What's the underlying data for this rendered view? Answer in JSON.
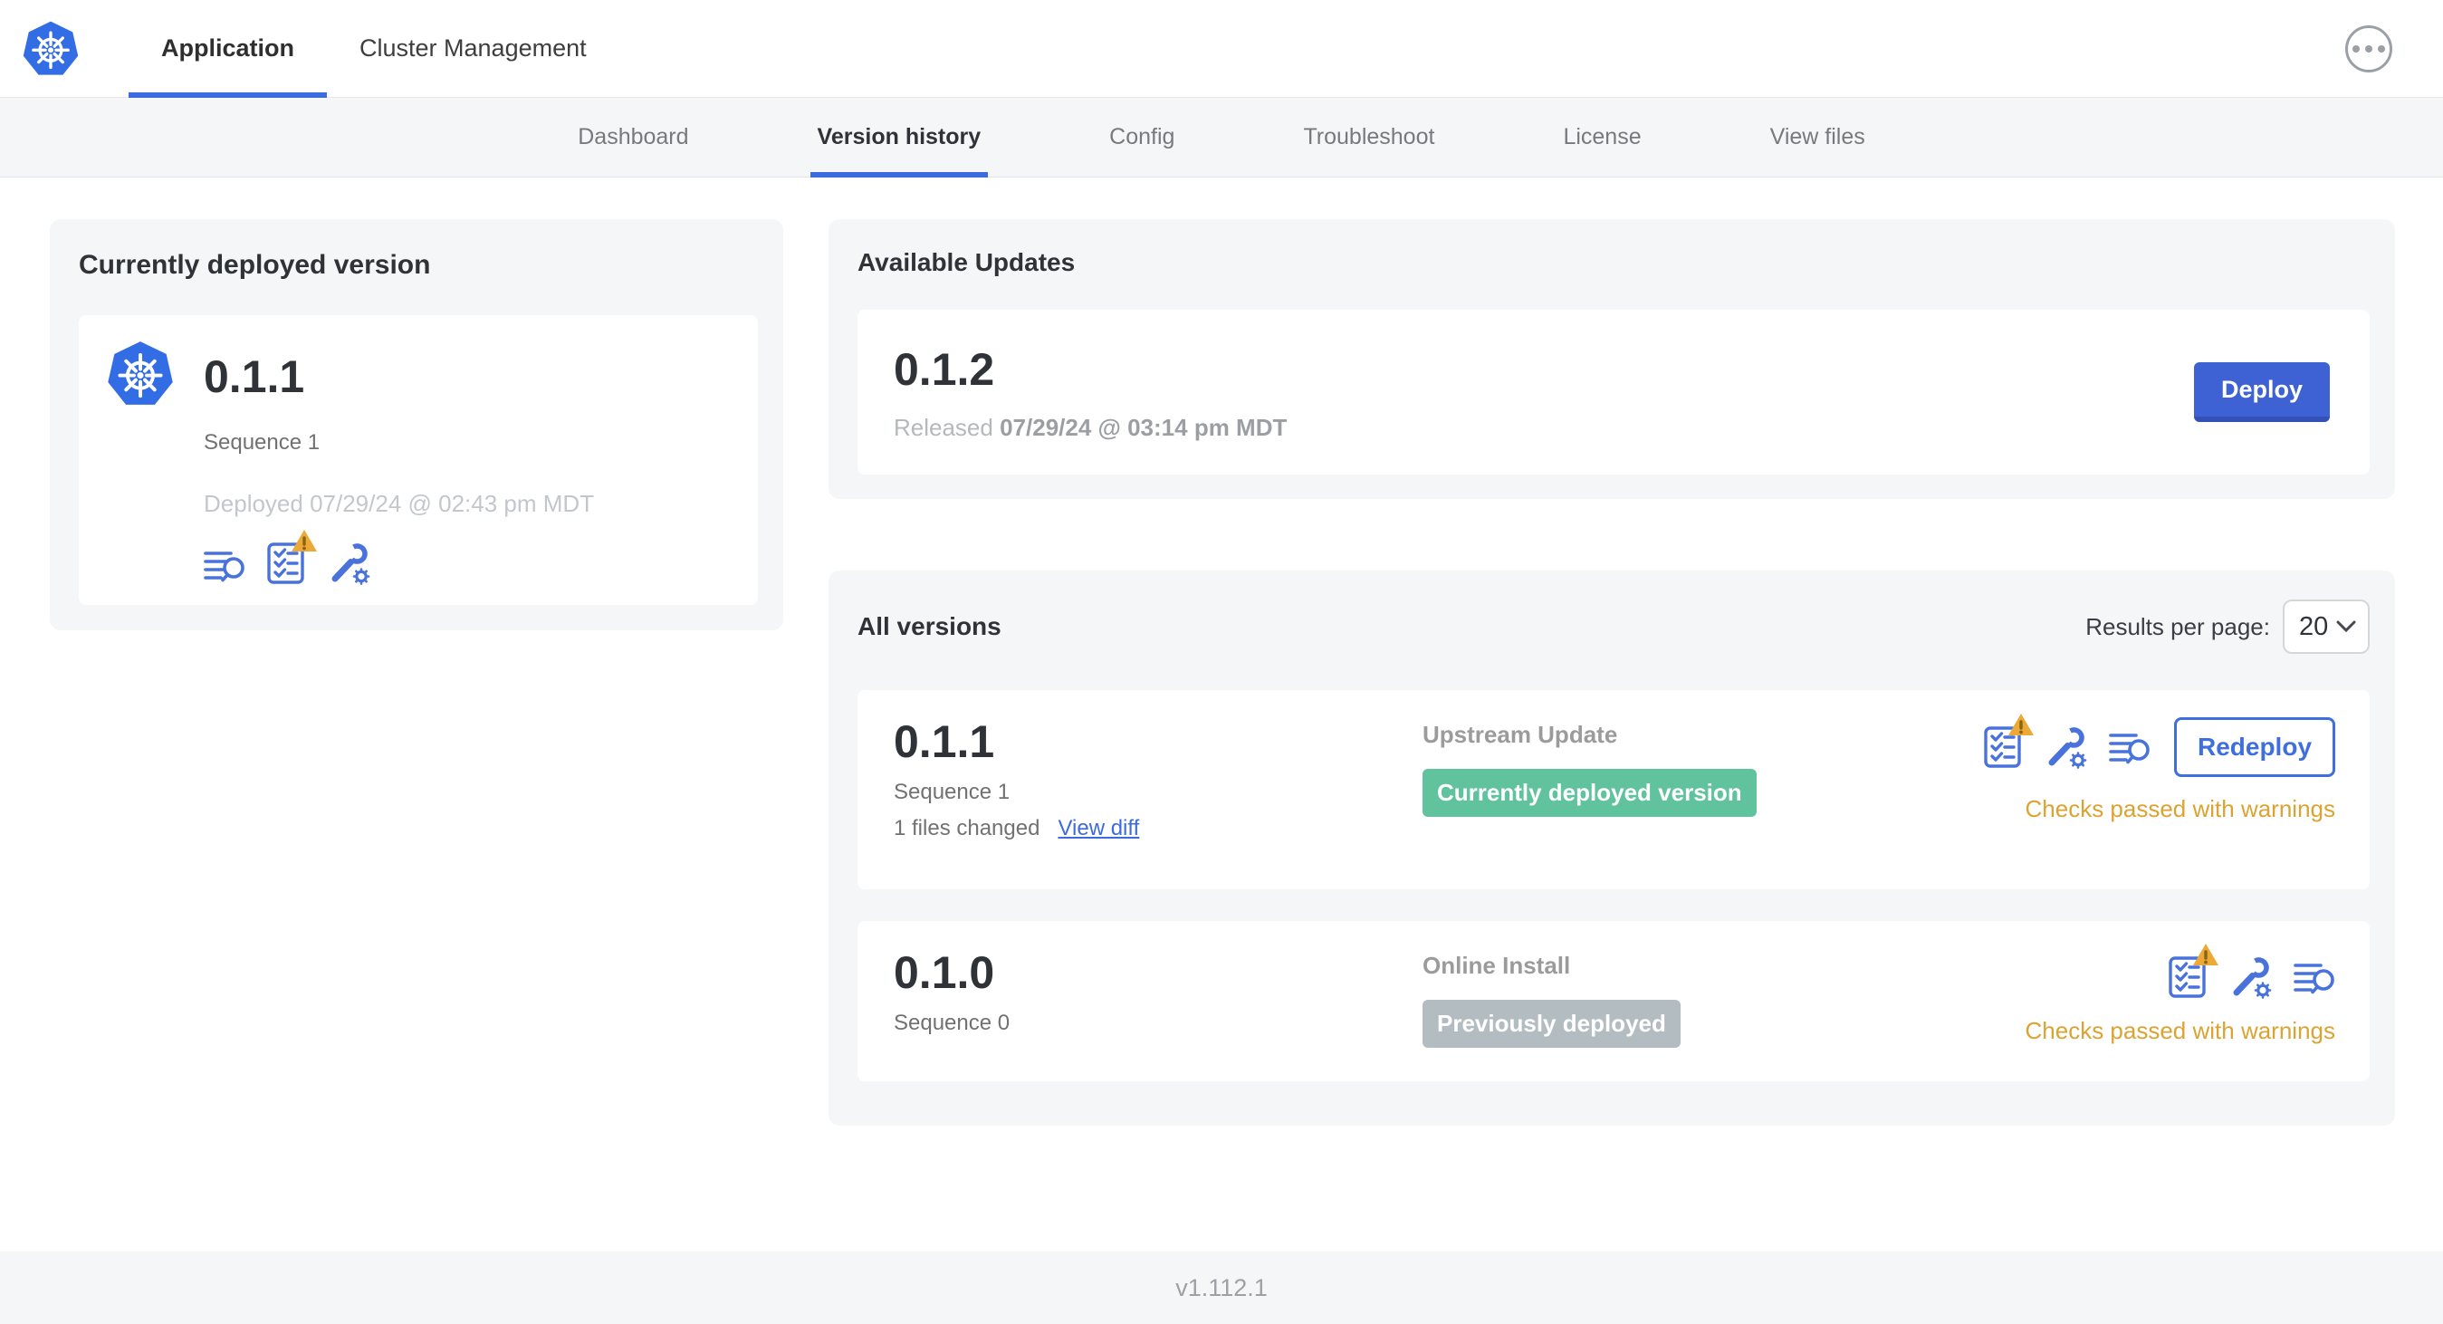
{
  "top_nav": {
    "tabs": [
      {
        "label": "Application",
        "active": true
      },
      {
        "label": "Cluster Management",
        "active": false
      }
    ],
    "overflow_menu_icon": "ellipsis-icon"
  },
  "sub_nav": {
    "tabs": [
      {
        "label": "Dashboard",
        "active": false
      },
      {
        "label": "Version history",
        "active": true
      },
      {
        "label": "Config",
        "active": false
      },
      {
        "label": "Troubleshoot",
        "active": false
      },
      {
        "label": "License",
        "active": false
      },
      {
        "label": "View files",
        "active": false
      }
    ]
  },
  "current_version_card": {
    "title": "Currently deployed version",
    "version": "0.1.1",
    "sequence": "Sequence 1",
    "deployed_text": "Deployed 07/29/24 @ 02:43 pm MDT",
    "icons": [
      "release-notes-icon",
      "preflight-checks-warning-icon",
      "config-icon"
    ],
    "app_icon": "kubernetes-logo"
  },
  "available_updates": {
    "title": "Available Updates",
    "update": {
      "version": "0.1.2",
      "released_label": "Released",
      "released_date": "07/29/24 @ 03:14 pm MDT",
      "deploy_button": "Deploy"
    }
  },
  "all_versions": {
    "title": "All versions",
    "results_per_page_label": "Results per page:",
    "results_per_page_value": "20",
    "rows": [
      {
        "version": "0.1.1",
        "sequence": "Sequence 1",
        "files_changed": "1 files changed",
        "view_diff_link": "View diff",
        "source": "Upstream Update",
        "badge": "Currently deployed version",
        "badge_style": "green",
        "icons": [
          "preflight-checks-warning-icon",
          "config-icon",
          "release-notes-icon"
        ],
        "action_button": "Redeploy",
        "status": "Checks passed with warnings"
      },
      {
        "version": "0.1.0",
        "sequence": "Sequence 0",
        "source": "Online Install",
        "badge": "Previously deployed",
        "badge_style": "gray",
        "icons": [
          "preflight-checks-warning-icon",
          "config-icon",
          "release-notes-icon"
        ],
        "status": "Checks passed with warnings"
      }
    ]
  },
  "footer": {
    "version": "v1.112.1"
  },
  "colors": {
    "accent_blue": "#3b6bde",
    "kubernetes_blue": "#326de6",
    "green_badge": "#61c39d",
    "gray_badge": "#b3bcc1",
    "warning_text": "#dca332",
    "warning_triangle": "#eba937",
    "panel_gray": "#f5f6f8"
  }
}
